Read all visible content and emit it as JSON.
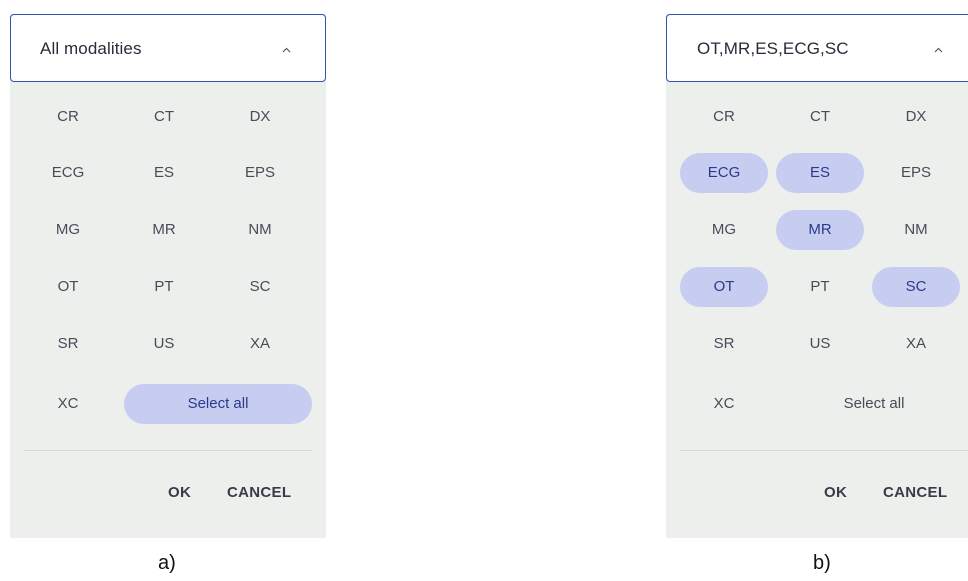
{
  "panel_a": {
    "header_label": "All modalities",
    "chevron_icon": "chevron-up-icon",
    "modalities": [
      {
        "label": "CR",
        "selected": false
      },
      {
        "label": "CT",
        "selected": false
      },
      {
        "label": "DX",
        "selected": false
      },
      {
        "label": "ECG",
        "selected": false
      },
      {
        "label": "ES",
        "selected": false
      },
      {
        "label": "EPS",
        "selected": false
      },
      {
        "label": "MG",
        "selected": false
      },
      {
        "label": "MR",
        "selected": false
      },
      {
        "label": "NM",
        "selected": false
      },
      {
        "label": "OT",
        "selected": false
      },
      {
        "label": "PT",
        "selected": false
      },
      {
        "label": "SC",
        "selected": false
      },
      {
        "label": "SR",
        "selected": false
      },
      {
        "label": "US",
        "selected": false
      },
      {
        "label": "XA",
        "selected": false
      },
      {
        "label": "XC",
        "selected": false
      }
    ],
    "select_all_label": "Select all",
    "select_all_selected": true,
    "ok_label": "OK",
    "cancel_label": "CANCEL",
    "caption": "a)"
  },
  "panel_b": {
    "header_label": "OT,MR,ES,ECG,SC",
    "chevron_icon": "chevron-up-icon",
    "modalities": [
      {
        "label": "CR",
        "selected": false
      },
      {
        "label": "CT",
        "selected": false
      },
      {
        "label": "DX",
        "selected": false
      },
      {
        "label": "ECG",
        "selected": true
      },
      {
        "label": "ES",
        "selected": true
      },
      {
        "label": "EPS",
        "selected": false
      },
      {
        "label": "MG",
        "selected": false
      },
      {
        "label": "MR",
        "selected": true
      },
      {
        "label": "NM",
        "selected": false
      },
      {
        "label": "OT",
        "selected": true
      },
      {
        "label": "PT",
        "selected": false
      },
      {
        "label": "SC",
        "selected": true
      },
      {
        "label": "SR",
        "selected": false
      },
      {
        "label": "US",
        "selected": false
      },
      {
        "label": "XA",
        "selected": false
      },
      {
        "label": "XC",
        "selected": false
      }
    ],
    "select_all_label": "Select all",
    "select_all_selected": false,
    "ok_label": "OK",
    "cancel_label": "CANCEL",
    "caption": "b)"
  },
  "colors": {
    "panel_bg": "#edefed",
    "selected_chip_bg": "#c7cdf0",
    "selected_chip_text": "#2b3a8a",
    "header_border": "#2f57a5"
  }
}
